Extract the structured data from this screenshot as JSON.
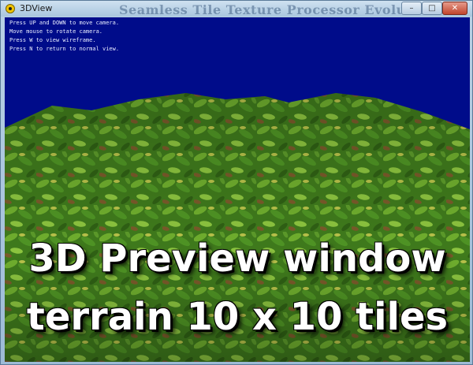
{
  "window": {
    "title": "3DView",
    "background_banner": "Seamless Tile Texture Processor Evolution",
    "controls": {
      "minimize": "–",
      "maximize": "□",
      "close": "✕"
    }
  },
  "viewport": {
    "sky_color": "#000c8a",
    "instructions": [
      "Press UP and DOWN to move camera.",
      "Move mouse to rotate camera.",
      "Press W to view wireframe.",
      "Press N to return to normal view."
    ]
  },
  "caption": {
    "line1": "3D Preview window",
    "line2": "terrain 10 x 10 tiles"
  }
}
